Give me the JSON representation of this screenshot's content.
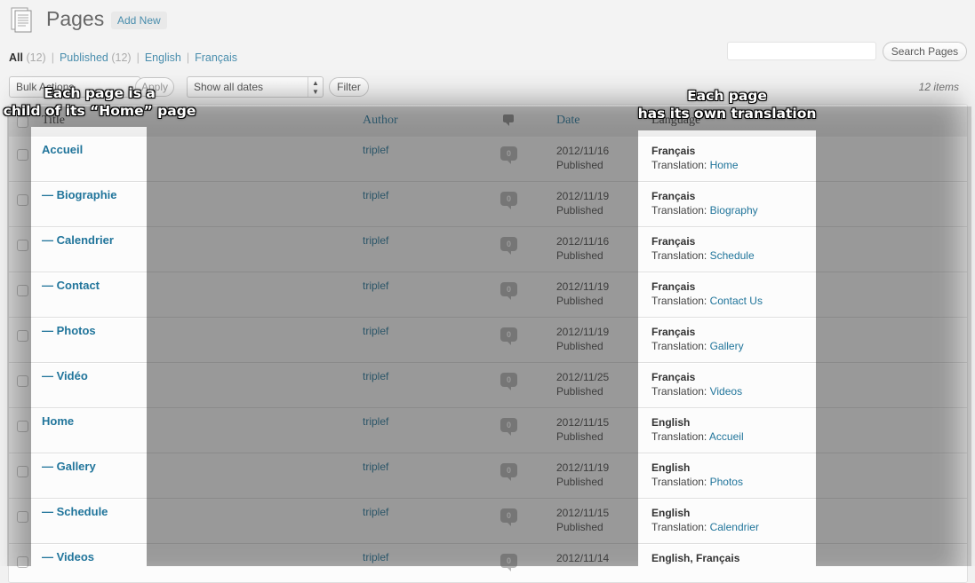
{
  "header": {
    "title": "Pages",
    "add_new": "Add New"
  },
  "views": [
    {
      "label": "All",
      "count": "(12)"
    },
    {
      "label": "Published",
      "count": "(12)"
    },
    {
      "label": "English"
    },
    {
      "label": "Français"
    }
  ],
  "search": {
    "button": "Search Pages",
    "placeholder": ""
  },
  "tablenav": {
    "bulk_action": "Bulk Actions",
    "apply": "Apply",
    "date_filter": "Show all dates",
    "filter": "Filter",
    "items": "12 items"
  },
  "columns": {
    "title": "Title",
    "author": "Author",
    "date": "Date",
    "language": "Language"
  },
  "rows": [
    {
      "title": "Accueil",
      "author": "triplef",
      "comments": "0",
      "date": "2012/11/16",
      "status": "Published",
      "language": "Français",
      "translation_label": "Translation:",
      "translation": "Home"
    },
    {
      "title": "— Biographie",
      "author": "triplef",
      "comments": "0",
      "date": "2012/11/19",
      "status": "Published",
      "language": "Français",
      "translation_label": "Translation:",
      "translation": "Biography"
    },
    {
      "title": "— Calendrier",
      "author": "triplef",
      "comments": "0",
      "date": "2012/11/16",
      "status": "Published",
      "language": "Français",
      "translation_label": "Translation:",
      "translation": "Schedule"
    },
    {
      "title": "— Contact",
      "author": "triplef",
      "comments": "0",
      "date": "2012/11/19",
      "status": "Published",
      "language": "Français",
      "translation_label": "Translation:",
      "translation": "Contact Us"
    },
    {
      "title": "— Photos",
      "author": "triplef",
      "comments": "0",
      "date": "2012/11/19",
      "status": "Published",
      "language": "Français",
      "translation_label": "Translation:",
      "translation": "Gallery"
    },
    {
      "title": "— Vidéo",
      "author": "triplef",
      "comments": "0",
      "date": "2012/11/25",
      "status": "Published",
      "language": "Français",
      "translation_label": "Translation:",
      "translation": "Videos"
    },
    {
      "title": "Home",
      "author": "triplef",
      "comments": "0",
      "date": "2012/11/15",
      "status": "Published",
      "language": "English",
      "translation_label": "Translation:",
      "translation": "Accueil"
    },
    {
      "title": "— Gallery",
      "author": "triplef",
      "comments": "0",
      "date": "2012/11/19",
      "status": "Published",
      "language": "English",
      "translation_label": "Translation:",
      "translation": "Photos"
    },
    {
      "title": "— Schedule",
      "author": "triplef",
      "comments": "0",
      "date": "2012/11/15",
      "status": "Published",
      "language": "English",
      "translation_label": "Translation:",
      "translation": "Calendrier"
    },
    {
      "title": "— Videos",
      "author": "triplef",
      "comments": "0",
      "date": "2012/11/14",
      "status": "",
      "language": "English, Français",
      "translation_label": "",
      "translation": ""
    }
  ],
  "annotations": {
    "note1_line1": "Each page is a",
    "note1_line2": "child of its “Home” page",
    "note2_line1": "Each page",
    "note2_line2": "has its own translation"
  }
}
